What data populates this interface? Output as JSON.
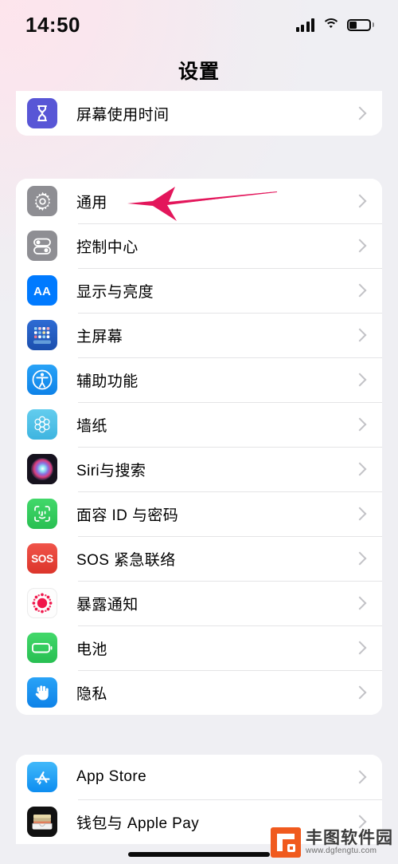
{
  "status_bar": {
    "time": "14:50",
    "signal_icon": "cellular-signal-icon",
    "wifi_icon": "wifi-icon",
    "battery_icon": "battery-icon",
    "battery_level_percent": 38
  },
  "nav": {
    "title": "设置"
  },
  "annotation": {
    "arrow_icon": "pointer-arrow-icon",
    "arrow_color": "#E91E63",
    "points_to": "通用"
  },
  "groups": [
    {
      "id": "group-screen-time",
      "rows": [
        {
          "label": "屏幕使用时间",
          "icon": "hourglass-icon",
          "icon_color": "#5856D6",
          "chevron": "chevron-right-icon"
        }
      ]
    },
    {
      "id": "group-system",
      "rows": [
        {
          "label": "通用",
          "icon": "gear-icon",
          "icon_color": "#8E8E93",
          "chevron": "chevron-right-icon"
        },
        {
          "label": "控制中心",
          "icon": "toggles-icon",
          "icon_color": "#8E8E93",
          "chevron": "chevron-right-icon"
        },
        {
          "label": "显示与亮度",
          "icon": "aa-text-icon",
          "icon_color": "#007AFF",
          "chevron": "chevron-right-icon"
        },
        {
          "label": "主屏幕",
          "icon": "home-screen-grid-icon",
          "icon_color": "#1B4FAE",
          "chevron": "chevron-right-icon"
        },
        {
          "label": "辅助功能",
          "icon": "accessibility-icon",
          "icon_color": "#1790F3",
          "chevron": "chevron-right-icon"
        },
        {
          "label": "墙纸",
          "icon": "wallpaper-flower-icon",
          "icon_color": "#4FC0E8",
          "chevron": "chevron-right-icon"
        },
        {
          "label": "Siri与搜索",
          "icon": "siri-orb-icon",
          "icon_color": "#1B1B2B",
          "chevron": "chevron-right-icon"
        },
        {
          "label": "面容 ID 与密码",
          "icon": "face-id-icon",
          "icon_color": "#34C759",
          "chevron": "chevron-right-icon"
        },
        {
          "label": "SOS 紧急联络",
          "icon": "sos-icon",
          "icon_color": "#EB4135",
          "chevron": "chevron-right-icon"
        },
        {
          "label": "暴露通知",
          "icon": "exposure-notification-icon",
          "icon_color": "#FFFFFF",
          "chevron": "chevron-right-icon"
        },
        {
          "label": "电池",
          "icon": "battery-green-icon",
          "icon_color": "#34C759",
          "chevron": "chevron-right-icon"
        },
        {
          "label": "隐私",
          "icon": "hand-privacy-icon",
          "icon_color": "#1790F3",
          "chevron": "chevron-right-icon"
        }
      ]
    },
    {
      "id": "group-store",
      "rows": [
        {
          "label": "App Store",
          "icon": "app-store-icon",
          "icon_color": "#1AA2F5",
          "chevron": "chevron-right-icon"
        },
        {
          "label": "钱包与 Apple Pay",
          "icon": "wallet-icon",
          "icon_color": "#101010",
          "chevron": "chevron-right-icon"
        }
      ]
    }
  ],
  "watermark": {
    "title": "丰图软件园",
    "url": "www.dgfengtu.com",
    "logo_color": "#F05A1E"
  }
}
